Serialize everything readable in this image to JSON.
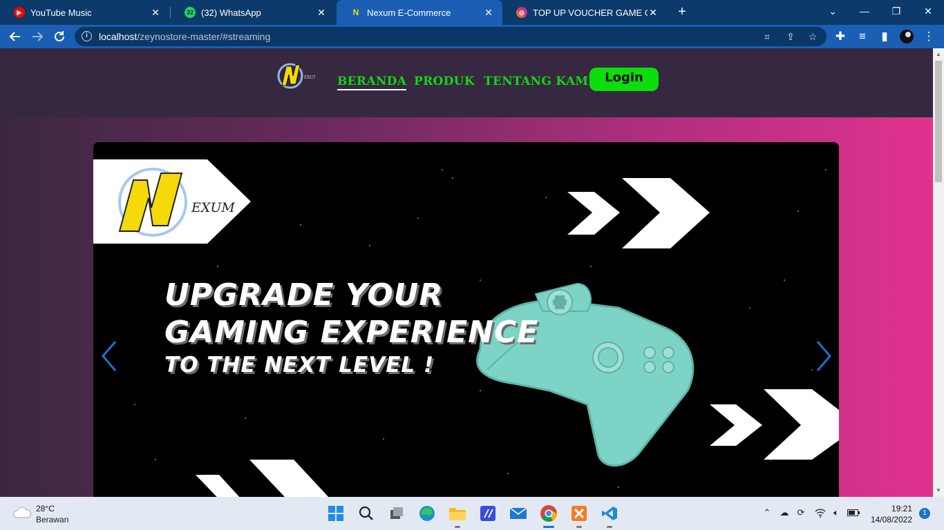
{
  "browser": {
    "tabs": [
      {
        "title": "YouTube Music",
        "icon": "youtube-music-icon",
        "color": "#ff0000"
      },
      {
        "title": "(32) WhatsApp",
        "icon": "whatsapp-icon",
        "color": "#25d366",
        "badge": "32"
      },
      {
        "title": "Nexum E-Commerce",
        "icon": "nexum-icon",
        "color": "#f5d90a"
      },
      {
        "title": "TOP UP VOUCHER GAME ONLINE",
        "icon": "instagram-icon",
        "color": "#e1306c"
      }
    ],
    "url_host": "localhost",
    "url_path": "/zeynostore-master/#streaming"
  },
  "site": {
    "logo_text": "NEXUM",
    "nav": {
      "home": "BERANDA",
      "products": "PRODUK",
      "about": "TENTANG KAMI",
      "login": "Login"
    },
    "banner": {
      "line1": "UPGRADE YOUR",
      "line2": "GAMING EXPERIENCE",
      "line3": "TO THE NEXT LEVEL !",
      "logo_text": "EXUM"
    },
    "colors": {
      "nav_link": "#14d614",
      "login_bg": "#0cde0c",
      "controller": "#7dd3c5",
      "carousel_arrow": "#1f6fd0"
    }
  },
  "taskbar": {
    "weather_temp": "28°C",
    "weather_desc": "Berawan",
    "time": "19:21",
    "date": "14/08/2022",
    "notifications": "1"
  }
}
